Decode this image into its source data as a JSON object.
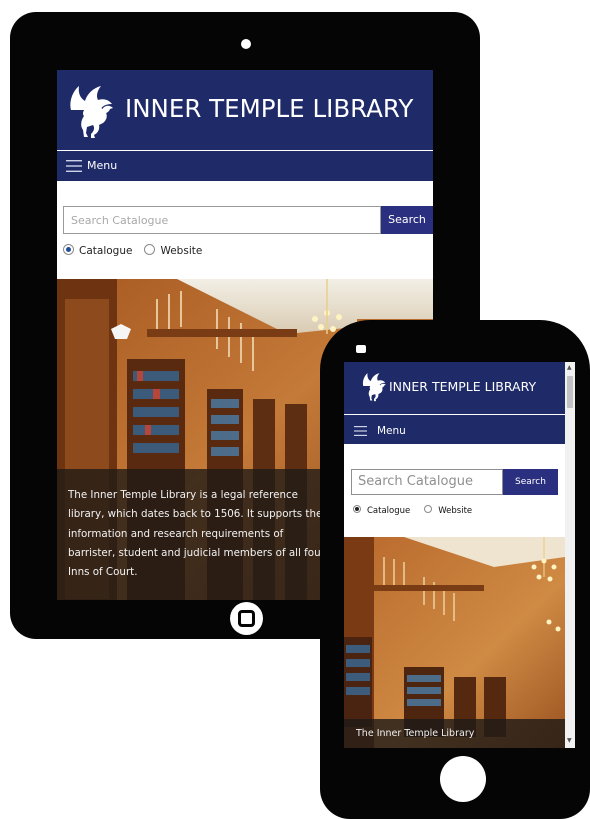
{
  "tablet": {
    "header": {
      "title": "INNER TEMPLE LIBRARY",
      "logo_icon": "pegasus-icon"
    },
    "menu": {
      "label": "Menu",
      "icon": "hamburger-menu-icon"
    },
    "search": {
      "placeholder": "Search Catalogue",
      "button_label": "Search"
    },
    "scope": {
      "options": [
        "Catalogue",
        "Website"
      ],
      "selected": "Catalogue"
    },
    "hero": {
      "caption": "The Inner Temple Library is a legal reference library, which dates back to 1506.  It supports the information and research requirements of barrister, student and judicial members of all four Inns of Court."
    }
  },
  "phone": {
    "header": {
      "title": "INNER TEMPLE LIBRARY",
      "logo_icon": "pegasus-icon"
    },
    "menu": {
      "label": "Menu",
      "icon": "hamburger-menu-icon"
    },
    "search": {
      "placeholder": "Search Catalogue",
      "button_label": "Search"
    },
    "scope": {
      "options": [
        "Catalogue",
        "Website"
      ],
      "selected": "Catalogue"
    },
    "hero": {
      "caption": "The Inner Temple Library"
    }
  },
  "colors": {
    "brand_navy": "#1f2a68",
    "button_blue": "#2b2f80",
    "device_black": "#050505"
  }
}
